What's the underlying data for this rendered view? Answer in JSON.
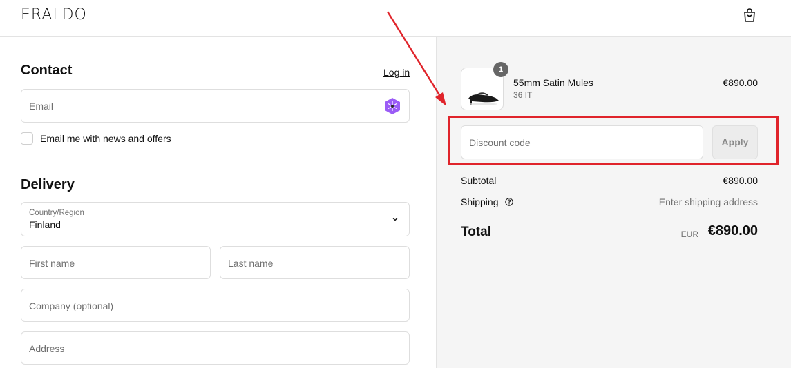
{
  "header": {
    "logo": "ERALDO",
    "bag_icon": "shopping-bag-icon"
  },
  "contact": {
    "title": "Contact",
    "login_link": "Log in",
    "email_placeholder": "Email",
    "newsletter_label": "Email me with news and offers",
    "newsletter_checked": false,
    "email_field_icon": "shop-pay-icon"
  },
  "delivery": {
    "title": "Delivery",
    "country_label": "Country/Region",
    "country_value": "Finland",
    "first_name_placeholder": "First name",
    "last_name_placeholder": "Last name",
    "company_placeholder": "Company (optional)",
    "address_placeholder": "Address"
  },
  "order": {
    "item": {
      "quantity": "1",
      "name": "55mm Satin Mules",
      "variant": "36 IT",
      "price": "€890.00"
    },
    "discount_placeholder": "Discount code",
    "apply_label": "Apply",
    "subtotal_label": "Subtotal",
    "subtotal_value": "€890.00",
    "shipping_label": "Shipping",
    "shipping_value": "Enter shipping address",
    "total_label": "Total",
    "total_currency": "EUR",
    "total_value": "€890.00"
  },
  "colors": {
    "annotation": "#e0242b",
    "summary_bg": "#f5f5f5",
    "shop_pay": "#9b5cf6"
  }
}
